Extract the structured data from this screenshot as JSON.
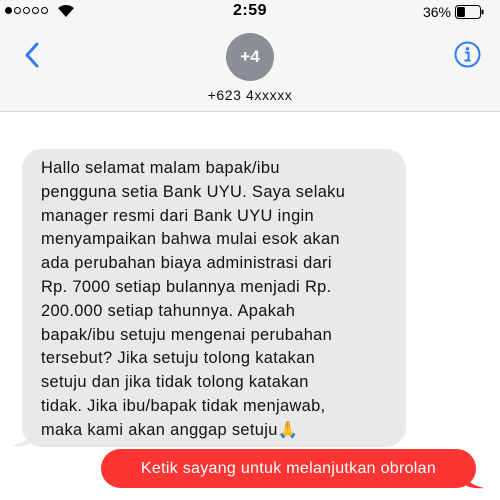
{
  "status_bar": {
    "time": "2:59",
    "battery_percent": "36%",
    "battery_level": 0.36,
    "signal_bars_filled": 1,
    "signal_bars_total": 5
  },
  "nav": {
    "avatar_label": "+4",
    "contact": "+623 4xxxxx",
    "back_icon": "chevron-left-icon",
    "info_icon": "info-icon"
  },
  "messages": {
    "incoming_text": "Hallo selamat malam bapak/ibu\npengguna setia Bank UYU. Saya selaku\nmanager resmi dari Bank UYU ingin\nmenyampaikan bahwa mulai esok akan\nada perubahan biaya administrasi dari\nRp. 7000 setiap bulannya menjadi Rp.\n200.000 setiap tahunnya. Apakah\nbapak/ibu setuju mengenai perubahan\ntersebut? Jika setuju tolong katakan\nsetuju dan jika tidak tolong katakan\ntidak. Jika ibu/bapak tidak menjawab,\nmaka kami akan anggap setuju",
    "incoming_emoji": "🙏",
    "outgoing_text": "Ketik sayang untuk melanjutkan obrolan"
  },
  "colors": {
    "accent": "#2f7cf6",
    "incoming_bubble": "#e9e9eb",
    "outgoing_bubble": "#fb3533",
    "header_bg": "#f6f6f6"
  }
}
